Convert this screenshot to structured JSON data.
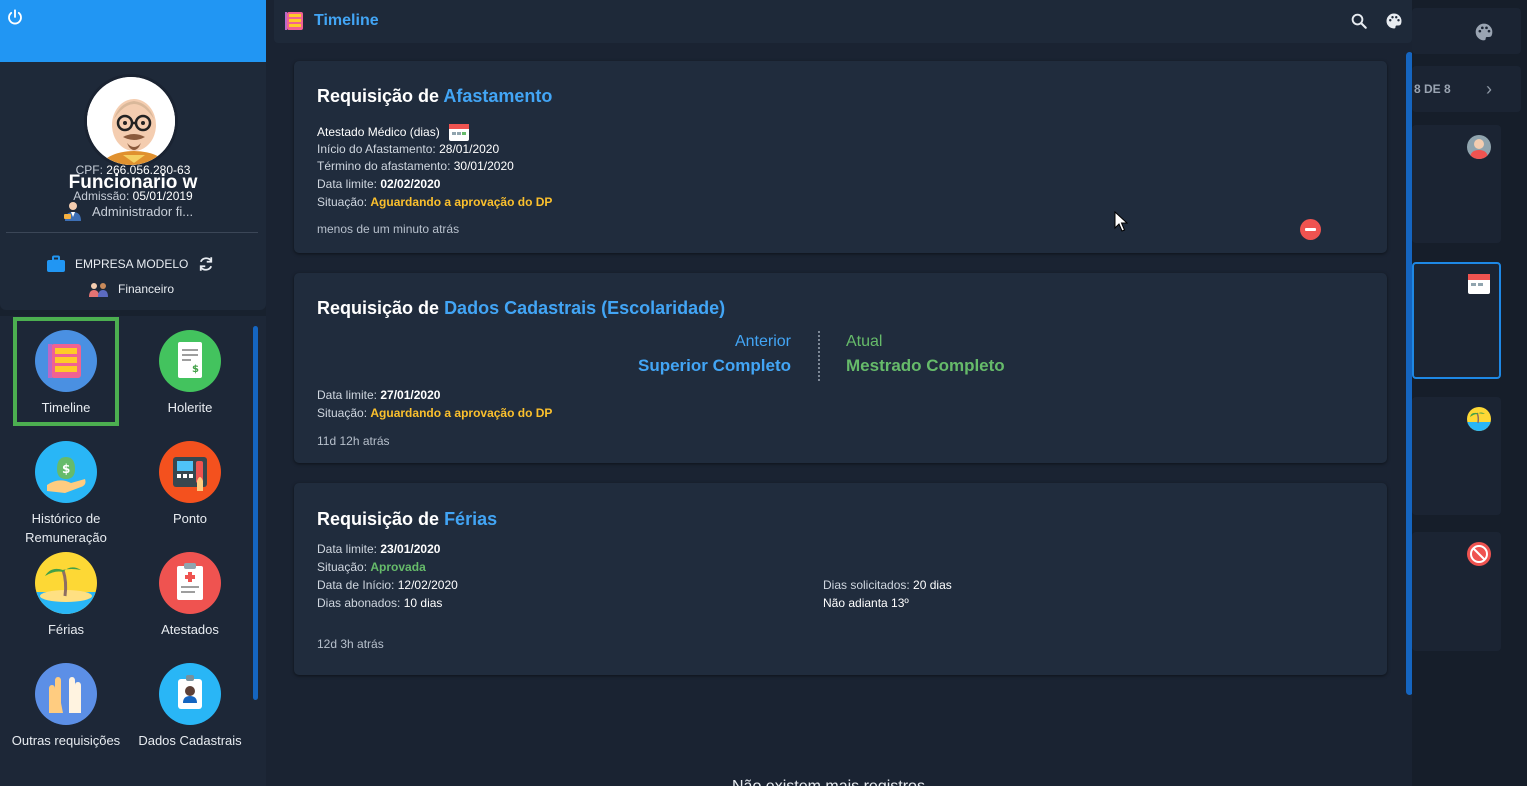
{
  "user": {
    "name": "Funcionario w",
    "role": "Administrador fi...",
    "cpf_label": "CPF:",
    "cpf": "266.056.280-63",
    "admission_label": "Admissão:",
    "admission": "05/01/2019"
  },
  "company": {
    "name": "EMPRESA MODELO",
    "department": "Financeiro"
  },
  "menu": {
    "items": [
      {
        "label": "Timeline",
        "icon": "timeline-icon"
      },
      {
        "label": "Holerite",
        "icon": "payslip-icon"
      },
      {
        "label": "Histórico de",
        "label2": "Remuneração",
        "icon": "money-hand-icon"
      },
      {
        "label": "Ponto",
        "icon": "time-clock-icon"
      },
      {
        "label": "Férias",
        "icon": "beach-icon"
      },
      {
        "label": "Atestados",
        "icon": "medical-certificate-icon"
      },
      {
        "label": "Outras requisições",
        "icon": "raised-hands-icon"
      },
      {
        "label": "Dados Cadastrais",
        "icon": "id-badge-icon"
      }
    ]
  },
  "header": {
    "title": "Timeline",
    "search_icon": "search-icon",
    "palette_icon": "palette-icon"
  },
  "cards": {
    "afastamento": {
      "title_prefix": "Requisição de",
      "title_highlight": "Afastamento",
      "type": "Atestado Médico (dias)",
      "start_label": "Início do Afastamento:",
      "start": "28/01/2020",
      "end_label": "Término do afastamento:",
      "end": "30/01/2020",
      "deadline_label": "Data limite:",
      "deadline": "02/02/2020",
      "status_label": "Situação:",
      "status": "Aguardando a aprovação do DP",
      "ago": "menos de um minuto atrás"
    },
    "cadastrais": {
      "title_prefix": "Requisição de",
      "title_highlight": "Dados Cadastrais (Escolaridade)",
      "prev_label": "Anterior",
      "prev_value": "Superior Completo",
      "cur_label": "Atual",
      "cur_value": "Mestrado Completo",
      "deadline_label": "Data limite:",
      "deadline": "27/01/2020",
      "status_label": "Situação:",
      "status": "Aguardando a aprovação do DP",
      "ago": "11d 12h atrás"
    },
    "ferias": {
      "title_prefix": "Requisição de",
      "title_highlight": "Férias",
      "deadline_label": "Data limite:",
      "deadline": "23/01/2020",
      "status_label": "Situação:",
      "status": "Aprovada",
      "start_label": "Data de Início:",
      "start": "12/02/2020",
      "bonus_label": "Dias abonados:",
      "bonus": "10 dias",
      "requested_label": "Dias solicitados:",
      "requested": "20 dias",
      "advance13": "Não adianta 13º",
      "ago": "12d 3h atrás"
    }
  },
  "empty_message": "Não existem mais registros",
  "right_panel": {
    "pager": "8 DE 8"
  },
  "colors": {
    "accent": "#42a5f5",
    "warning": "#fbc02d",
    "success": "#66bb6a",
    "danger": "#ef5350",
    "selected_outline": "#4caf50"
  }
}
